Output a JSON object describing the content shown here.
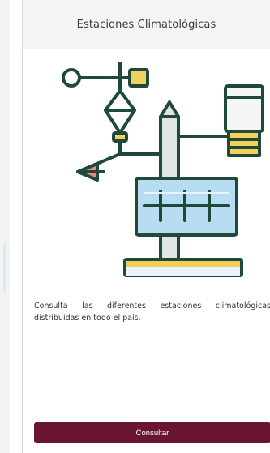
{
  "card": {
    "title": "Estaciones Climatológicas",
    "description": "Consulta las diferentes estaciones climatológicas distribuidas en todo el país.",
    "button_label": "Consultar"
  },
  "illustration": {
    "icon": "weather-station-icon",
    "colors": {
      "outline": "#1f4a3a",
      "pole": "#dfe6e4",
      "gold": "#f3cf5c",
      "red_flag": "#f08b7e",
      "panel_blue": "#b8dcf2",
      "panel_light": "#e8f4fb"
    }
  },
  "theme": {
    "accent": "#6b1534",
    "header_bg": "#f4f4f4"
  }
}
